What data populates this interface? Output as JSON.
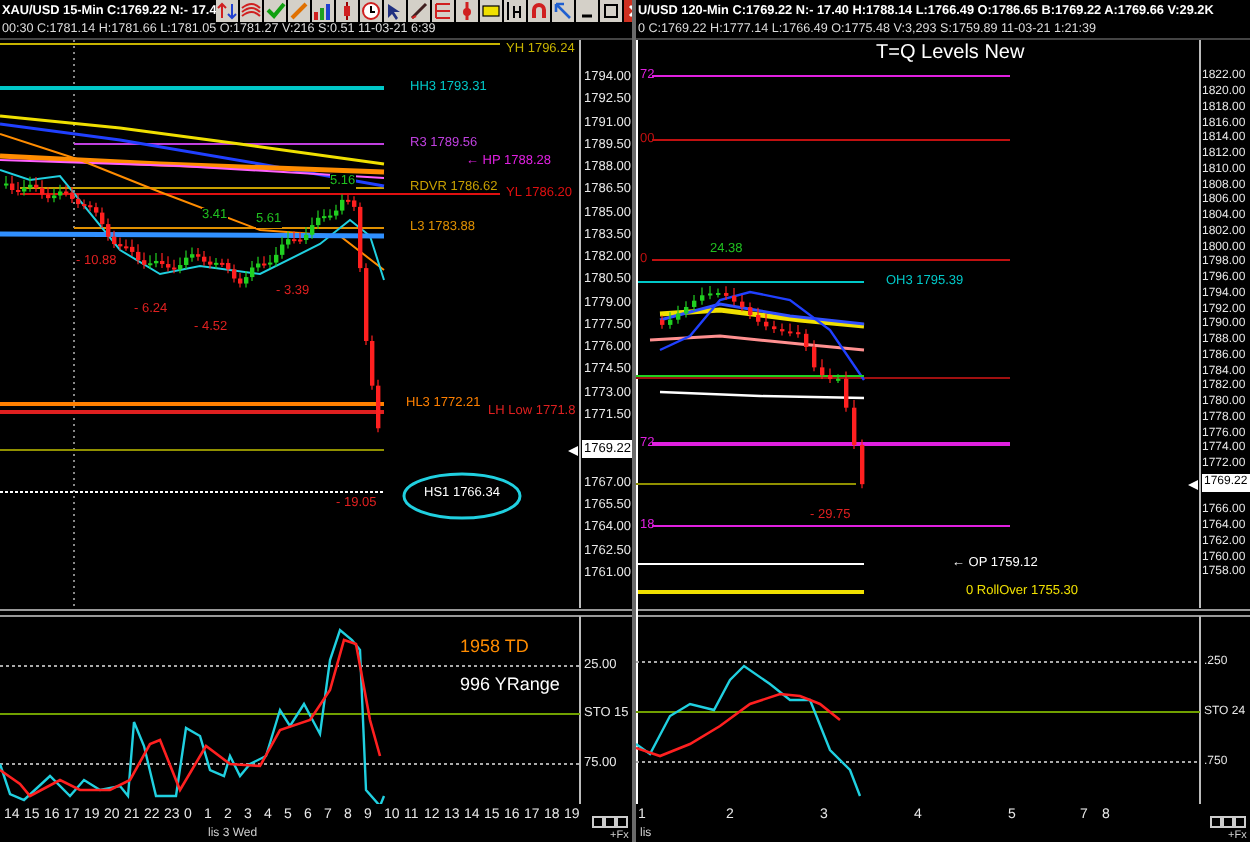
{
  "left_chart": {
    "title": "XAU/USD 15-Min C:1769.22 N:- 17.4",
    "info": "00:30  C:1781.14  H:1781.66  L:1781.05  O:1781.27  V:216  S:0.51  11-03-21  6:39",
    "levels": [
      {
        "text": "YH 1796.24",
        "color": "#c8b400"
      },
      {
        "text": "HH3 1793.31",
        "color": "#00c8c8"
      },
      {
        "text": "R3 1789.56",
        "color": "#c040e0"
      },
      {
        "text": "← HP 1788.28",
        "color": "#e020e0"
      },
      {
        "text": "RDVR 1786.62",
        "color": "#c8a000"
      },
      {
        "text": "YL 1786.20",
        "color": "#e01010"
      },
      {
        "text": "L3 1783.88",
        "color": "#e09000"
      },
      {
        "text": "HL3 1772.21",
        "color": "#ff8000"
      },
      {
        "text": "LH Low 1771.8",
        "color": "#e02020"
      },
      {
        "text": "HS1 1766.34",
        "color": "#ffffff"
      }
    ],
    "annotations": [
      {
        "text": "5.16",
        "color": "#20c020"
      },
      {
        "text": "5.61",
        "color": "#20c020"
      },
      {
        "text": "3.41",
        "color": "#20c020"
      },
      {
        "text": "- 10.88",
        "color": "#e02020"
      },
      {
        "text": "- 6.24",
        "color": "#e02020"
      },
      {
        "text": "- 4.52",
        "color": "#e02020"
      },
      {
        "text": "- 3.39",
        "color": "#e02020"
      },
      {
        "text": "- 19.05",
        "color": "#e02020"
      }
    ],
    "price_axis": [
      "1794.00",
      "1792.50",
      "1791.00",
      "1789.50",
      "1788.00",
      "1786.50",
      "1785.00",
      "1783.50",
      "1782.00",
      "1780.50",
      "1779.00",
      "1777.50",
      "1776.00",
      "1774.50",
      "1773.00",
      "1771.50",
      "1767.00",
      "1765.50",
      "1764.00",
      "1762.50",
      "1761.00"
    ],
    "current_price": "1769.22",
    "oscillator": {
      "notes": [
        {
          "text": "1958 TD",
          "color": "#ff8c00"
        },
        {
          "text": "996 YRange",
          "color": "#ffffff"
        }
      ],
      "axis": [
        "25.00",
        "STO 15",
        "75.00"
      ]
    },
    "time_axis": [
      "14",
      "15",
      "16",
      "17",
      "19",
      "20",
      "21",
      "22",
      "23",
      "0",
      "1",
      "2",
      "3",
      "4",
      "5",
      "6",
      "7",
      "8",
      "9",
      "10",
      "11",
      "12",
      "13",
      "14",
      "15",
      "16",
      "17",
      "18",
      "19"
    ],
    "time_note": "lis 3 Wed",
    "corner_label": "+Fx"
  },
  "right_chart": {
    "title": "U/USD 120-Min C:1769.22 N:- 17.40 H:1788.14 L:1766.49 O:1786.65 B:1769.22 A:1769.66 V:29.2K",
    "info": "0 C:1769.22 H:1777.14 L:1766.49 O:1775.48 V:3,293 S:1759.89 11-03-21 1:21:39",
    "study_title": "T=Q Levels New",
    "levels": [
      {
        "text": "72",
        "color": "#e020e0"
      },
      {
        "text": "00",
        "color": "#c01010"
      },
      {
        "text": "0",
        "color": "#c01010"
      },
      {
        "text": "OH3 1795.39",
        "color": "#00c8c8"
      },
      {
        "text": "72",
        "color": "#e020e0"
      },
      {
        "text": "18",
        "color": "#e020e0"
      },
      {
        "text": "← OP 1759.12",
        "color": "#ffffff"
      },
      {
        "text": "0 RollOver 1755.30",
        "color": "#f0e000"
      }
    ],
    "annotations": [
      {
        "text": "24.38",
        "color": "#20c020"
      },
      {
        "text": "- 29.75",
        "color": "#e02020"
      }
    ],
    "price_axis": [
      "1822.00",
      "1820.00",
      "1818.00",
      "1816.00",
      "1814.00",
      "1812.00",
      "1810.00",
      "1808.00",
      "1806.00",
      "1804.00",
      "1802.00",
      "1800.00",
      "1798.00",
      "1796.00",
      "1794.00",
      "1792.00",
      "1790.00",
      "1788.00",
      "1786.00",
      "1784.00",
      "1782.00",
      "1780.00",
      "1778.00",
      "1776.00",
      "1774.00",
      "1772.00",
      "1766.00",
      "1764.00",
      "1762.00",
      "1760.00",
      "1758.00"
    ],
    "current_price": "1769.22",
    "oscillator": {
      "axis": [
        ".250",
        "STO 24",
        ".750"
      ]
    },
    "time_axis": [
      "1",
      "2",
      "3",
      "4",
      "5",
      "7",
      "8"
    ],
    "time_note": "lis",
    "corner_label": "+Fx"
  }
}
